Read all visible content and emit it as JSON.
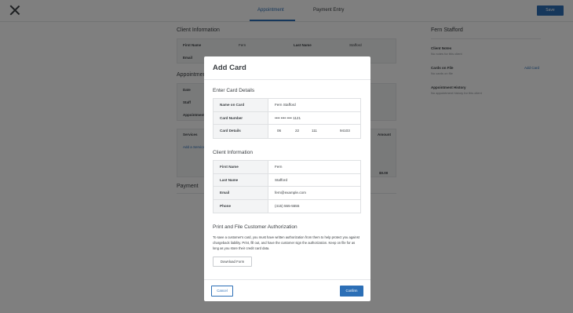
{
  "app": {
    "tabs": [
      "Appointment",
      "Payment Entry"
    ],
    "save_label": "Save",
    "left": {
      "client_info_title": "Client Information",
      "first_name_label": "First Name",
      "first_name_value": "Fern",
      "last_name_label": "Last Name",
      "last_name_value": "Stafford",
      "email_label": "Email",
      "appointment_title": "Appointment",
      "date_label": "Date",
      "staff_label": "Staff",
      "appointment_label": "Appointment",
      "services_label": "Services",
      "amount_label": "Amount",
      "add_service_label": "Add a Service",
      "total_value": "$0.00",
      "payment_title": "Payment"
    },
    "right": {
      "client_name": "Fern Stafford",
      "client_notes_title": "Client Notes",
      "client_notes_value": "No notes for this client",
      "cards_on_file_title": "Cards on File",
      "cards_on_file_value": "No cards on file",
      "add_card_link": "Add Card",
      "history_title": "Appointment History",
      "history_value": "No appointment history for this client"
    }
  },
  "modal": {
    "title": "Add Card",
    "card_section": {
      "title": "Enter Card Details",
      "rows": [
        {
          "label": "Name on Card",
          "value": "Fern Stafford"
        },
        {
          "label": "Card Number",
          "value": "•••• •••• •••• 1121"
        },
        {
          "label": "Card Details",
          "value": ""
        }
      ],
      "card_details": {
        "month": "06",
        "year": "22",
        "cvv": "111",
        "zip": "94103"
      }
    },
    "client_section": {
      "title": "Client Information",
      "rows": [
        {
          "label": "First Name",
          "value": "Fern"
        },
        {
          "label": "Last Name",
          "value": "Stafford"
        },
        {
          "label": "Email",
          "value": "fern@example.com"
        },
        {
          "label": "Phone",
          "value": "(415) 555-5555"
        }
      ]
    },
    "auth_section": {
      "title": "Print and File Customer Authorization",
      "text": "To save a customer's card, you must have written authorization from them to help protect you against chargeback liability. Print, fill out, and have the customer sign the authorization. Keep on file for as long as you store their credit card data.",
      "download_label": "Download Form"
    },
    "footer": {
      "cancel_label": "Cancel",
      "confirm_label": "Confirm"
    }
  },
  "colors": {
    "accent": "#2c6fb6",
    "overlay": "rgba(0,0,0,0.5)"
  }
}
